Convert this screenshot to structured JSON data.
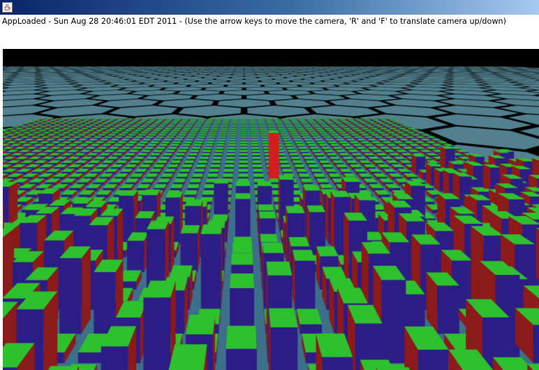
{
  "window": {
    "title_icon": "java-cup-icon",
    "title": ""
  },
  "status": {
    "message": "AppLoaded - Sun Aug 28 20:46:01 EDT 2011 - (Use the arrow keys to move the camera, 'R' and 'F' to translate camera up/down)"
  },
  "scene": {
    "description_icon": "3d-render",
    "colors": {
      "background": "#000000",
      "hex_tile": "#53808e",
      "grid_floor": "#3b6f8a",
      "cube_top": "#2ec12e",
      "cube_front": "#2c1d86",
      "cube_side": "#8c1a1a",
      "highlight_column": "#d41e1e"
    }
  }
}
